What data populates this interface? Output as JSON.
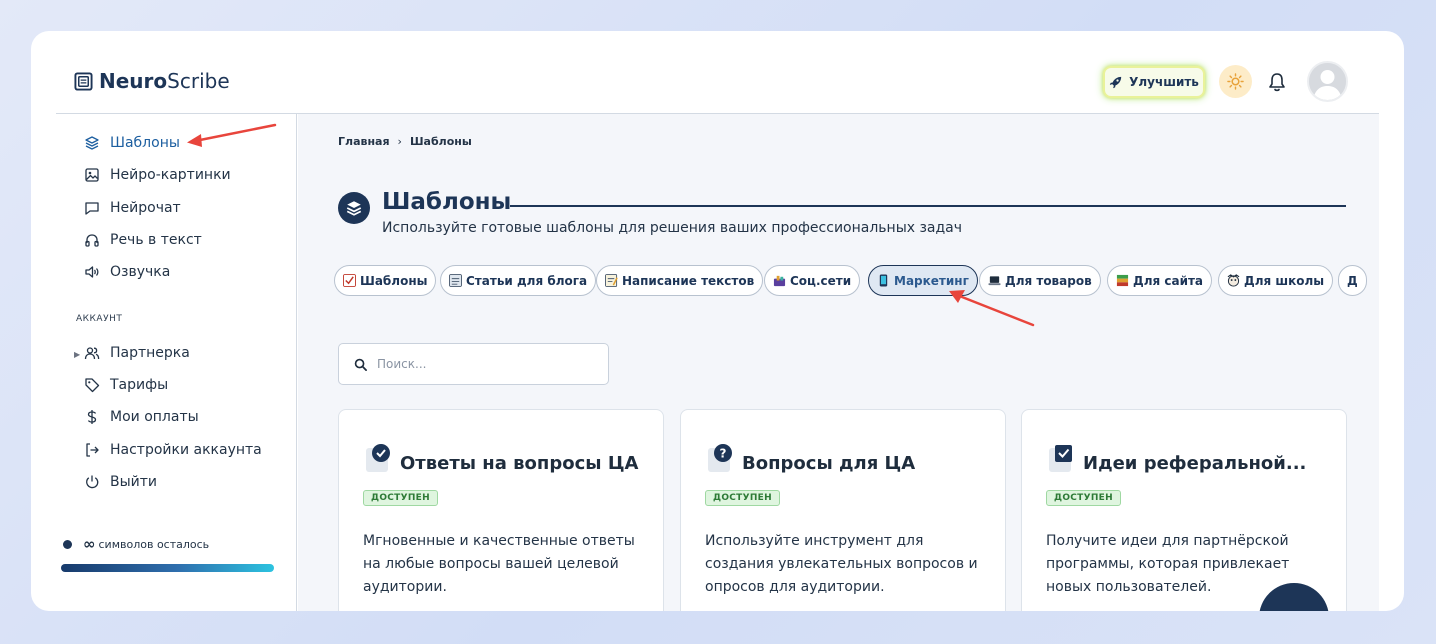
{
  "app": {
    "logo_bold": "Neuro",
    "logo_rest": "Scribe"
  },
  "header": {
    "upgrade_label": "Улучшить"
  },
  "sidebar": {
    "items": [
      {
        "label": "Шаблоны",
        "icon": "layers-icon"
      },
      {
        "label": "Нейро-картинки",
        "icon": "image-icon"
      },
      {
        "label": "Нейрочат",
        "icon": "chat-icon"
      },
      {
        "label": "Речь в текст",
        "icon": "headphones-icon"
      },
      {
        "label": "Озвучка",
        "icon": "speaker-icon"
      }
    ],
    "account_label": "АККАУНТ",
    "account_items": [
      {
        "label": "Партнерка",
        "icon": "users-icon"
      },
      {
        "label": "Тарифы",
        "icon": "tag-icon"
      },
      {
        "label": "Мои оплаты",
        "icon": "dollar-icon"
      },
      {
        "label": "Настройки аккаунта",
        "icon": "login-icon"
      },
      {
        "label": "Выйти",
        "icon": "power-icon"
      }
    ],
    "credits_symbol": "∞",
    "credits_label": "символов осталось"
  },
  "main": {
    "breadcrumb": {
      "home": "Главная",
      "separator": "›",
      "current": "Шаблоны"
    },
    "title": "Шаблоны",
    "subtitle": "Используйте готовые шаблоны для решения ваших профессиональных задач",
    "search_placeholder": "Поиск...",
    "categories": [
      {
        "label": "Шаблоны",
        "active": false
      },
      {
        "label": "Статьи для блога",
        "active": false
      },
      {
        "label": "Написание текстов",
        "active": false
      },
      {
        "label": "Соц.сети",
        "active": false
      },
      {
        "label": "Маркетинг",
        "active": true
      },
      {
        "label": "Для товаров",
        "active": false
      },
      {
        "label": "Для сайта",
        "active": false
      },
      {
        "label": "Для школы",
        "active": false
      },
      {
        "label": "Д",
        "active": false
      }
    ],
    "cards": [
      {
        "title": "Ответы на вопросы ЦА",
        "badge": "ДОСТУПЕН",
        "desc": "Мгновенные и качественные ответы на любые вопросы вашей целевой аудитории.",
        "icon": "check-circle-icon"
      },
      {
        "title": "Вопросы для ЦА",
        "badge": "ДОСТУПЕН",
        "desc": "Используйте инструмент для создания увлекательных вопросов и опросов для аудитории.",
        "icon": "question-circle-icon"
      },
      {
        "title": "Идеи реферальной...",
        "badge": "ДОСТУПЕН",
        "desc": "Получите идеи для партнёрской программы, которая привлекает новых пользователей.",
        "icon": "checkbox-icon"
      }
    ]
  },
  "colors": {
    "accent": "#1d3557",
    "active_link": "#1d5fa0",
    "badge_green": "#2d7a36",
    "annotation_arrow": "#e8453c"
  }
}
